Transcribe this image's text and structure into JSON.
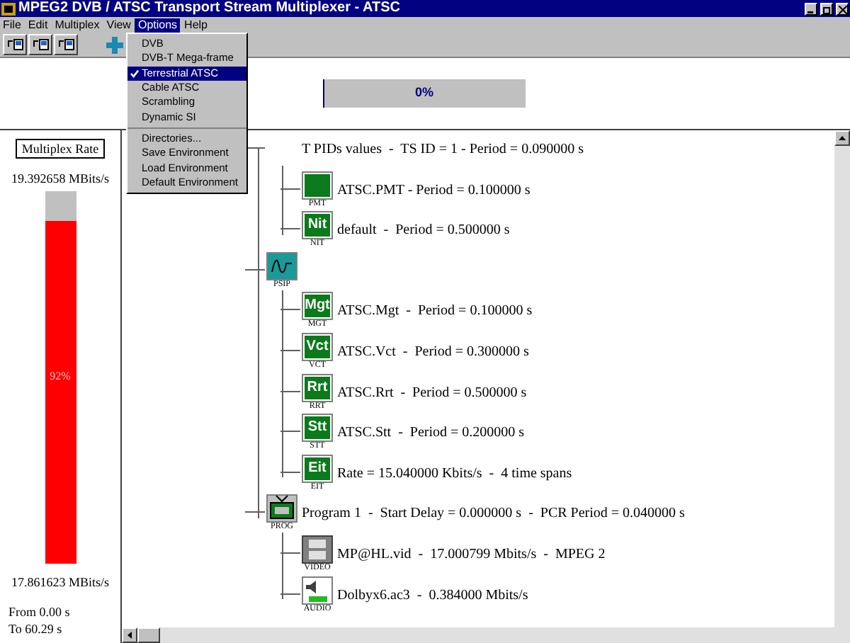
{
  "window": {
    "title": "MPEG2 DVB / ATSC Transport Stream Multiplexer - ATSC"
  },
  "menu": [
    {
      "label": "File",
      "selected": false
    },
    {
      "label": "Edit",
      "selected": false
    },
    {
      "label": "Multiplex",
      "selected": false
    },
    {
      "label": "View",
      "selected": false
    },
    {
      "label": "Options",
      "selected": true
    },
    {
      "label": "Help",
      "selected": false
    }
  ],
  "dropdown": {
    "groups": [
      [
        {
          "label": "DVB",
          "checked": false,
          "selected": false
        },
        {
          "label": "DVB-T Mega-frame",
          "checked": false,
          "selected": false
        },
        {
          "label": "Terrestrial ATSC",
          "checked": true,
          "selected": true
        },
        {
          "label": "Cable ATSC",
          "checked": false,
          "selected": false
        },
        {
          "label": "Scrambling",
          "checked": false,
          "selected": false
        },
        {
          "label": "Dynamic SI",
          "checked": false,
          "selected": false
        }
      ],
      [
        {
          "label": "Directories...",
          "checked": false,
          "selected": false
        },
        {
          "label": "Save Environment",
          "checked": false,
          "selected": false
        },
        {
          "label": "Load Environment",
          "checked": false,
          "selected": false
        },
        {
          "label": "Default Environment",
          "checked": false,
          "selected": false
        }
      ]
    ]
  },
  "progress": {
    "text": "0%",
    "level": 0
  },
  "rate_panel": {
    "title": "Multiplex Rate",
    "max": "19.392658 MBits/s",
    "level": 0.92,
    "bar_text": "92%",
    "min": "17.861623 MBits/s",
    "from": "From 0.00 s",
    "to": "To 60.29 s"
  },
  "tree": [
    {
      "kind": "hidden",
      "text": "T PIDs values  -  TS ID = 1 - Period = 0.090000 s",
      "children": [
        {
          "kind": "table",
          "caption": "PMT",
          "text": "ATSC.PMT - Period = 0.100000 s"
        },
        {
          "kind": "table",
          "tile": "Nit",
          "caption": "NIT",
          "text": "default  -  Period = 0.500000 s"
        }
      ]
    },
    {
      "kind": "psip",
      "caption": "PSIP",
      "children": [
        {
          "kind": "table",
          "tile": "Mgt",
          "caption": "MGT",
          "text": "ATSC.Mgt  -  Period = 0.100000 s"
        },
        {
          "kind": "table",
          "tile": "Vct",
          "caption": "VCT",
          "text": "ATSC.Vct  -  Period = 0.300000 s"
        },
        {
          "kind": "table",
          "tile": "Rrt",
          "caption": "RRT",
          "text": "ATSC.Rrt  -  Period = 0.500000 s"
        },
        {
          "kind": "table",
          "tile": "Stt",
          "caption": "STT",
          "text": "ATSC.Stt  -  Period = 0.200000 s"
        },
        {
          "kind": "table",
          "tile": "Eit",
          "caption": "EIT",
          "text": "Rate = 15.040000 Kbits/s  -  4 time spans"
        }
      ]
    },
    {
      "kind": "prog",
      "caption": "PROG",
      "text": "Program 1  -  Start Delay = 0.000000 s  -  PCR Period = 0.040000 s",
      "children": [
        {
          "kind": "video",
          "caption": "VIDEO",
          "text": "MP@HL.vid  -  17.000799 Mbits/s  -  MPEG 2"
        },
        {
          "kind": "audio",
          "caption": "AUDIO",
          "text": "Dolbyx6.ac3  -  0.384000 Mbits/s"
        }
      ]
    }
  ]
}
